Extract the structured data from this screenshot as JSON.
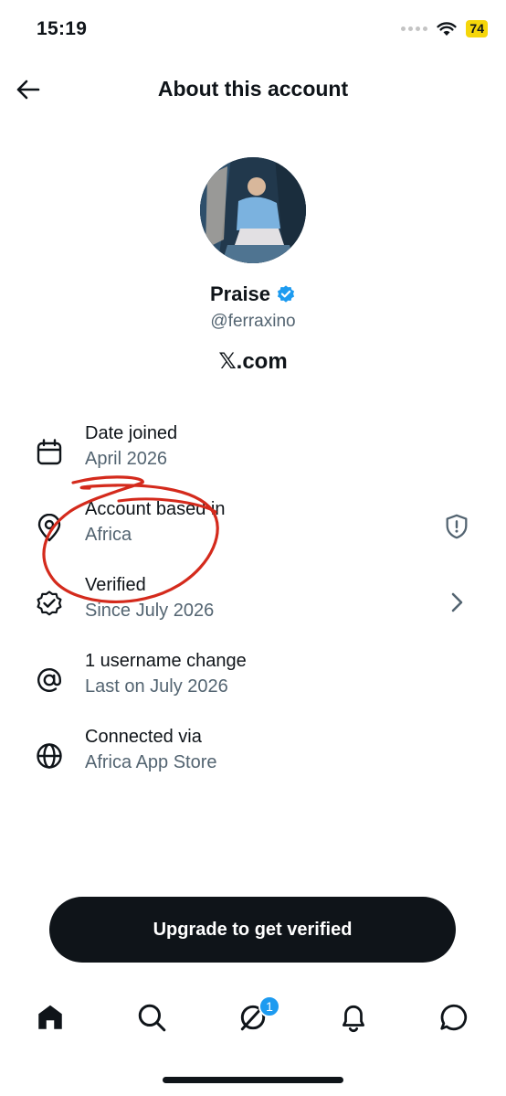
{
  "status_bar": {
    "time": "15:19",
    "battery": "74"
  },
  "header": {
    "title": "About this account"
  },
  "profile": {
    "name": "Praise",
    "handle": "@ferraxino",
    "site": "𝕏.com"
  },
  "info_rows": [
    {
      "label": "Date joined",
      "value": "April 2026",
      "icon": "calendar-icon"
    },
    {
      "label": "Account based in",
      "value": "Africa",
      "icon": "location-pin-icon",
      "action": "shield-alert-icon"
    },
    {
      "label": "Verified",
      "value": "Since July 2026",
      "icon": "verified-badge-icon",
      "action": "chevron-right-icon"
    },
    {
      "label": "1 username change",
      "value": "Last on July 2026",
      "icon": "at-sign-icon"
    },
    {
      "label": "Connected via",
      "value": "Africa App Store",
      "icon": "globe-icon"
    }
  ],
  "upgrade": {
    "label": "Upgrade to get verified"
  },
  "bottom_nav": {
    "items": [
      "home-icon",
      "search-icon",
      "grok-icon",
      "notifications-icon",
      "messages-icon"
    ],
    "grok_badge": "1"
  },
  "colors": {
    "text": "#0f1419",
    "secondary": "#536471",
    "accent": "#1d9bf0",
    "battery": "#f5d60a",
    "annotation": "#d42a1c"
  }
}
